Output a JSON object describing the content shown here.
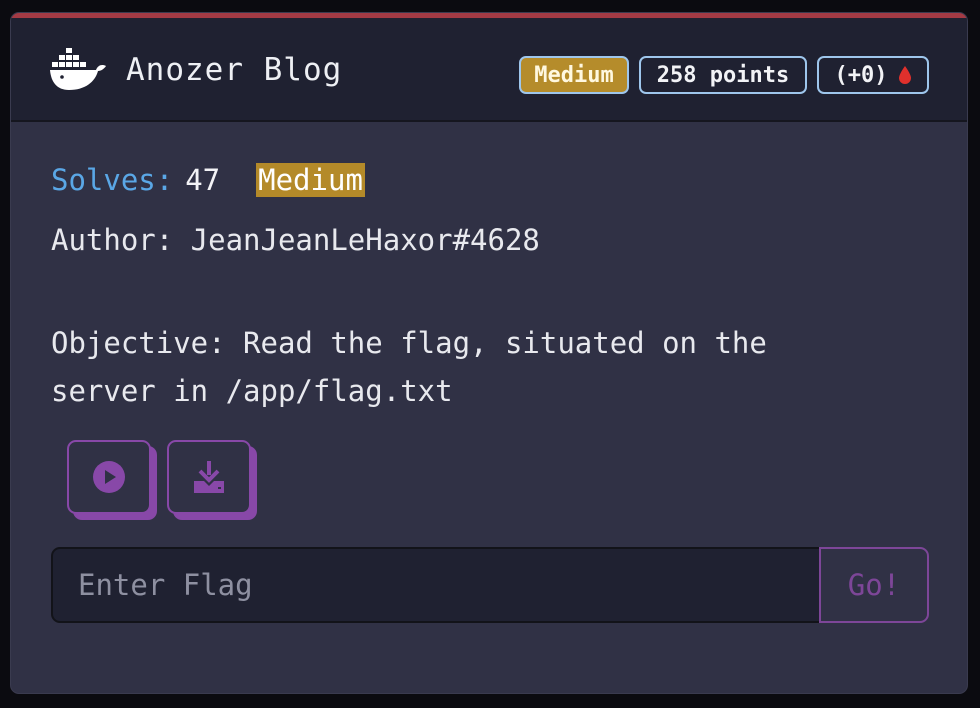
{
  "challenge": {
    "title": "Anozer Blog",
    "icon": "docker-whale-icon",
    "difficulty": "Medium",
    "points": "258 points",
    "delta": "(+0)"
  },
  "details": {
    "solves_label": "Solves:",
    "solves_value": "47",
    "difficulty_tag": "Medium",
    "author": "Author: JeanJeanLeHaxor#4628",
    "objective": "Objective: Read the flag, situated on the\nserver in /app/flag.txt"
  },
  "actions": {
    "start_icon": "play-icon",
    "download_icon": "download-icon"
  },
  "flag_form": {
    "placeholder": "Enter Flag",
    "value": "",
    "submit_label": "Go!"
  },
  "colors": {
    "accent_bar": "#a33a44",
    "difficulty_medium": "#b58c2b",
    "solves_label": "#5aa7e6",
    "button_purple": "#8848a8",
    "blood_drop": "#e0302c"
  }
}
